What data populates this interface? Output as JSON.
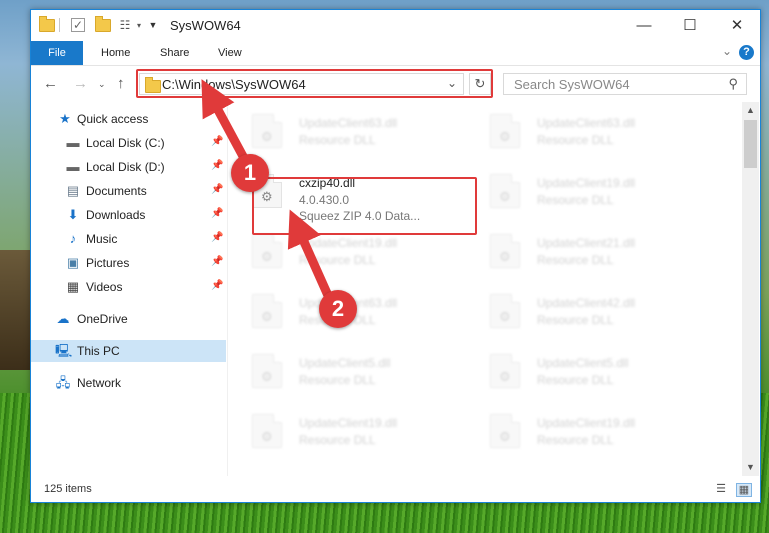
{
  "window": {
    "title": "SysWOW64",
    "minimize": "—",
    "maximize": "☐",
    "close": "✕"
  },
  "ribbon": {
    "tabs": [
      "File",
      "Home",
      "Share",
      "View"
    ],
    "help": "?"
  },
  "address": {
    "path": "C:\\Windows\\SysWOW64",
    "search_placeholder": "Search SysWOW64"
  },
  "nav_pane": {
    "items": [
      {
        "label": "Quick access",
        "icon": "star-icon"
      },
      {
        "label": "Local Disk (C:)",
        "icon": "drive-icon"
      },
      {
        "label": "Local Disk (D:)",
        "icon": "drive-icon"
      },
      {
        "label": "Documents",
        "icon": "document-icon"
      },
      {
        "label": "Downloads",
        "icon": "download-icon"
      },
      {
        "label": "Music",
        "icon": "music-icon"
      },
      {
        "label": "Pictures",
        "icon": "picture-icon"
      },
      {
        "label": "Videos",
        "icon": "video-icon"
      },
      {
        "label": "OneDrive",
        "icon": "cloud-icon"
      },
      {
        "label": "This PC",
        "icon": "computer-icon"
      },
      {
        "label": "Network",
        "icon": "network-icon"
      }
    ]
  },
  "files": {
    "left": [
      {
        "name": "UpdateClient63.dll",
        "desc": "Resource DLL"
      },
      {
        "name": "cxzip40.dll",
        "version": "4.0.430.0",
        "desc": "Squeez ZIP 4.0 Data..."
      },
      {
        "name": "UpdateClient19.dll",
        "desc": "Resource DLL"
      },
      {
        "name": "UpdateClient63.dll",
        "desc": "Resource DLL"
      },
      {
        "name": "UpdateClient5.dll",
        "desc": "Resource DLL"
      },
      {
        "name": "UpdateClient19.dll",
        "desc": "Resource DLL"
      }
    ],
    "right": [
      {
        "name": "UpdateClient63.dll",
        "desc": "Resource DLL"
      },
      {
        "name": "UpdateClient19.dll",
        "desc": "Resource DLL"
      },
      {
        "name": "UpdateClient21.dll",
        "desc": "Resource DLL"
      },
      {
        "name": "UpdateClient42.dll",
        "desc": "Resource DLL"
      },
      {
        "name": "UpdateClient5.dll",
        "desc": "Resource DLL"
      },
      {
        "name": "UpdateClient19.dll",
        "desc": "Resource DLL"
      }
    ]
  },
  "status": {
    "item_count": "125 items"
  },
  "annotations": {
    "badge1": "1",
    "badge2": "2",
    "color": "#e03a3a"
  }
}
